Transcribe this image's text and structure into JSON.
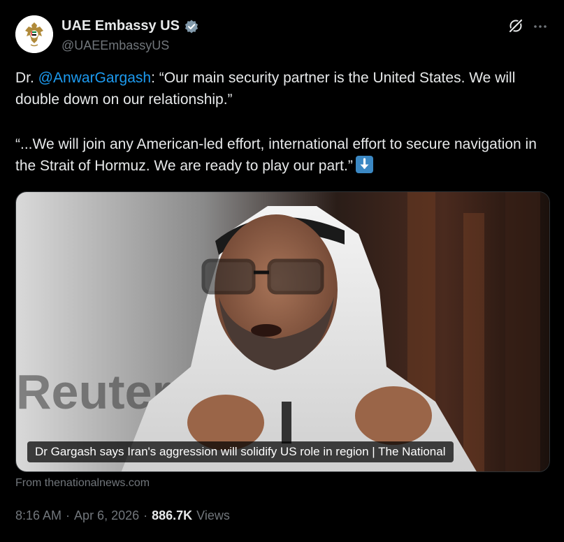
{
  "author": {
    "display_name": "UAE Embassy US",
    "handle": "@UAEEmbassyUS",
    "verified": true,
    "avatar_icon": "uae-emblem-icon"
  },
  "header_icons": {
    "grok": "grok-icon",
    "more": "more-icon"
  },
  "tweet": {
    "line1_prefix": "Dr. ",
    "mention": "@AnwarGargash",
    "line1_suffix": ": “Our main security partner is the United States. We will double down on our relationship.”",
    "line2": "“...We will join any American-led effort, international effort to secure navigation in the Strait of Hormuz. We are ready to play our part.”",
    "emoji": "down-arrow-emoji"
  },
  "media": {
    "caption": "Dr Gargash says Iran's aggression will solidify US role in region | The National",
    "source": "From thenationalnews.com"
  },
  "meta": {
    "time": "8:16 AM",
    "date": "Apr 6, 2026",
    "separator": "·",
    "views_count": "886.7K",
    "views_label": "Views"
  },
  "colors": {
    "background": "#000000",
    "text": "#e7e9ea",
    "secondary": "#71767b",
    "accent": "#1d9bf0"
  }
}
